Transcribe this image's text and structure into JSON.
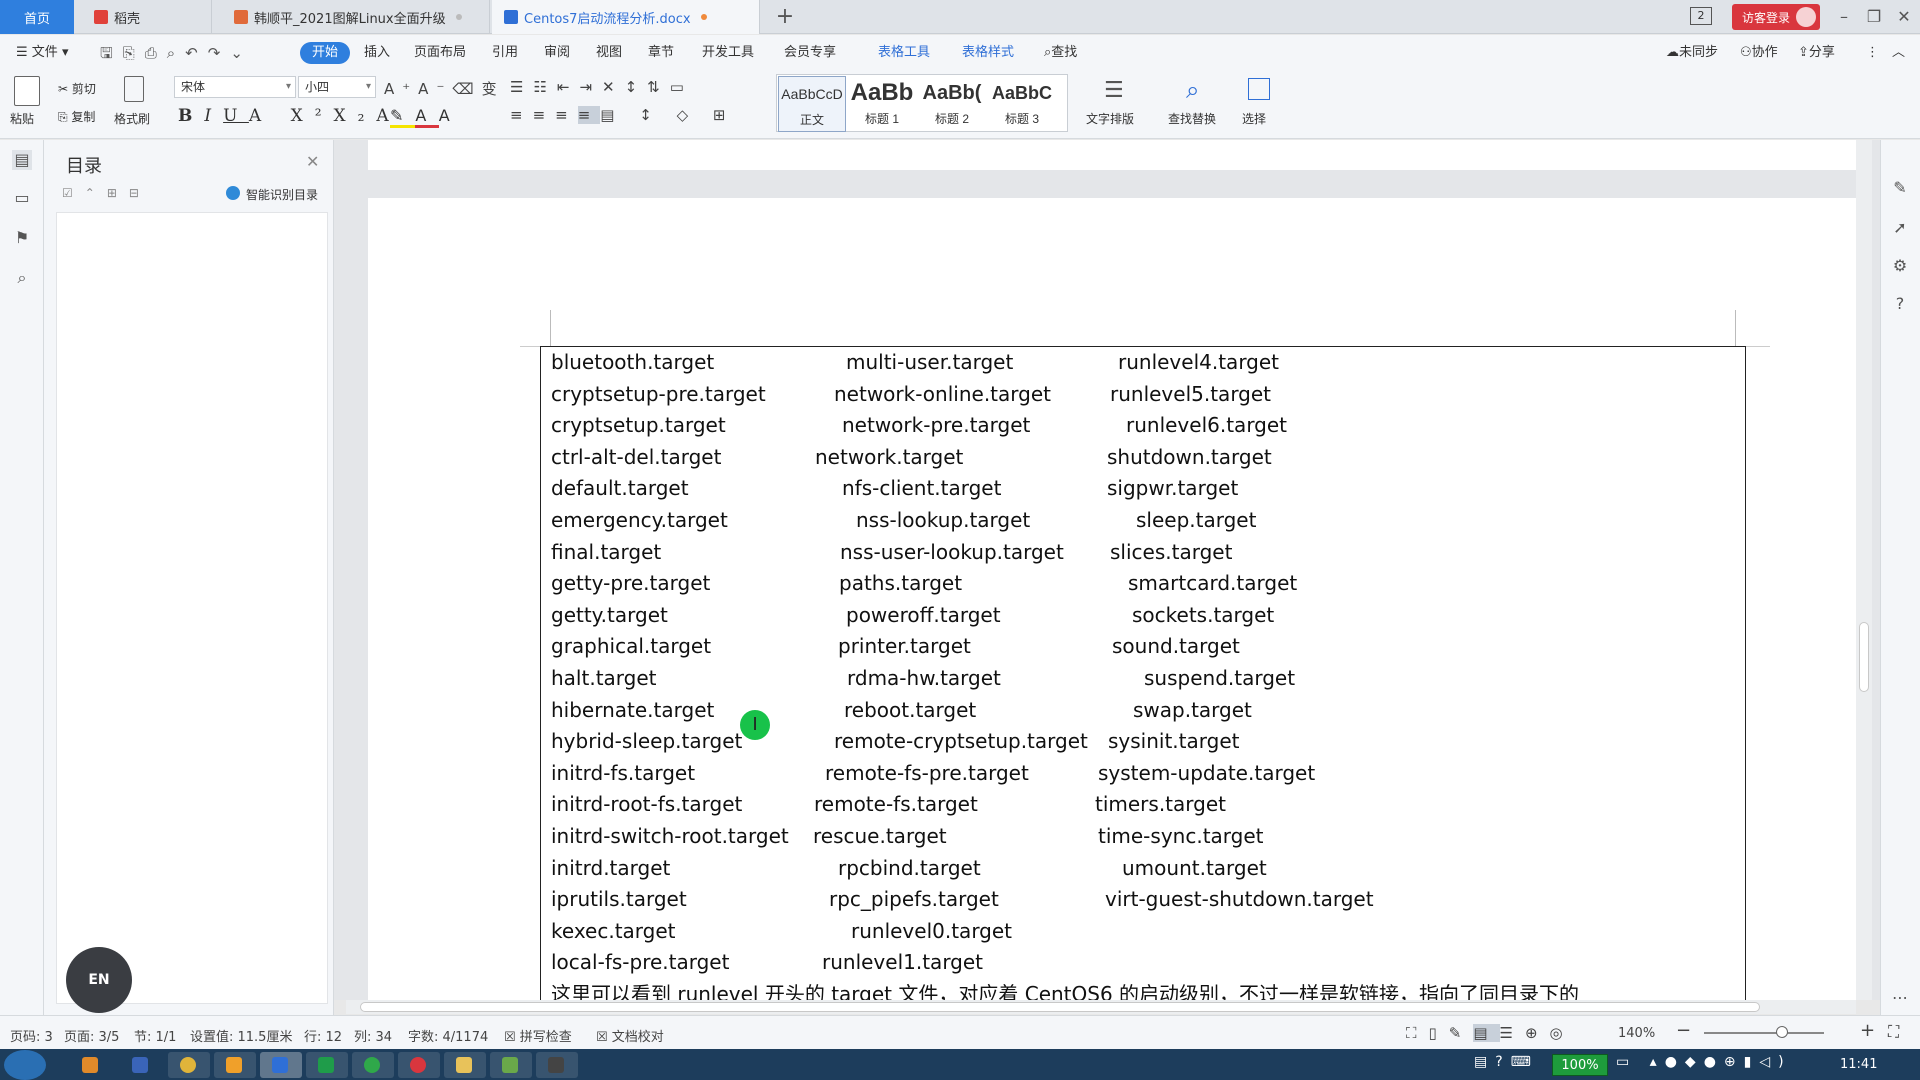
{
  "tabs": {
    "home": "首页",
    "daoke": "稻壳",
    "ppt": "韩顺平_2021图解Linux全面升级",
    "doc": "Centos7启动流程分析.docx"
  },
  "title_bar": {
    "badge": "2",
    "login": "访客登录"
  },
  "menu": {
    "file": "文件",
    "items": [
      "开始",
      "插入",
      "页面布局",
      "引用",
      "审阅",
      "视图",
      "章节",
      "开发工具",
      "会员专享"
    ],
    "table_tools": "表格工具",
    "table_style": "表格样式",
    "search": "查找",
    "sync": "未同步",
    "collab": "协作",
    "share": "分享"
  },
  "ribbon": {
    "paste": "粘贴",
    "cut": "剪切",
    "copy": "复制",
    "format_painter": "格式刷",
    "font": "宋体",
    "size": "小四",
    "styles": [
      {
        "preview": "AaBbCcD",
        "label": "正文"
      },
      {
        "preview": "AaBb",
        "label": "标题 1"
      },
      {
        "preview": "AaBb(",
        "label": "标题 2"
      },
      {
        "preview": "AaBbC",
        "label": "标题 3"
      }
    ],
    "text_layout": "文字排版",
    "find_replace": "查找替换",
    "select": "选择"
  },
  "toc": {
    "title": "目录",
    "smart": "智能识别目录"
  },
  "input_method": "EN",
  "table_rows": [
    [
      "bluetooth.target",
      "multi-user.target",
      "runlevel4.target"
    ],
    [
      "cryptsetup-pre.target",
      "network-online.target",
      "runlevel5.target"
    ],
    [
      "cryptsetup.target",
      "network-pre.target",
      "runlevel6.target"
    ],
    [
      "ctrl-alt-del.target",
      "network.target",
      "shutdown.target"
    ],
    [
      "default.target",
      "nfs-client.target",
      "sigpwr.target"
    ],
    [
      "emergency.target",
      "nss-lookup.target",
      "sleep.target"
    ],
    [
      "final.target",
      "nss-user-lookup.target",
      "slices.target"
    ],
    [
      "getty-pre.target",
      "paths.target",
      "smartcard.target"
    ],
    [
      "getty.target",
      "poweroff.target",
      "sockets.target"
    ],
    [
      "graphical.target",
      "printer.target",
      "sound.target"
    ],
    [
      "halt.target",
      "rdma-hw.target",
      "suspend.target"
    ],
    [
      "hibernate.target",
      "reboot.target",
      "swap.target"
    ],
    [
      "hybrid-sleep.target",
      "remote-cryptsetup.target",
      "sysinit.target"
    ],
    [
      "initrd-fs.target",
      "remote-fs-pre.target",
      "system-update.target"
    ],
    [
      "initrd-root-fs.target",
      "remote-fs.target",
      "timers.target"
    ],
    [
      "initrd-switch-root.target",
      "rescue.target",
      "time-sync.target"
    ],
    [
      "initrd.target",
      "rpcbind.target",
      "umount.target"
    ],
    [
      "iprutils.target",
      "rpc_pipefs.target",
      "virt-guest-shutdown.target"
    ],
    [
      "kexec.target",
      "runlevel0.target",
      ""
    ],
    [
      "local-fs-pre.target",
      "runlevel1.target",
      ""
    ]
  ],
  "paragraph": "这里可以看到 runlevel 开头的 target 文件，对应着 CentOS6 的启动级别，不过一样是软链接，指向了同目录下的",
  "status": {
    "page_code": "页码: 3",
    "page": "页面: 3/5",
    "section": "节: 1/1",
    "setting": "设置值: 11.5厘米",
    "row": "行: 12",
    "col": "列: 34",
    "words": "字数: 4/1174",
    "spell": "拼写检查",
    "proof": "文档校对",
    "zoom": "140%"
  },
  "taskbar": {
    "battery": "100%",
    "time": "11:41"
  },
  "colors": {
    "accent": "#2f7fde",
    "login_red": "#d9363e",
    "cursor_green": "#18c24a",
    "taskbar": "#1d3d5c"
  }
}
